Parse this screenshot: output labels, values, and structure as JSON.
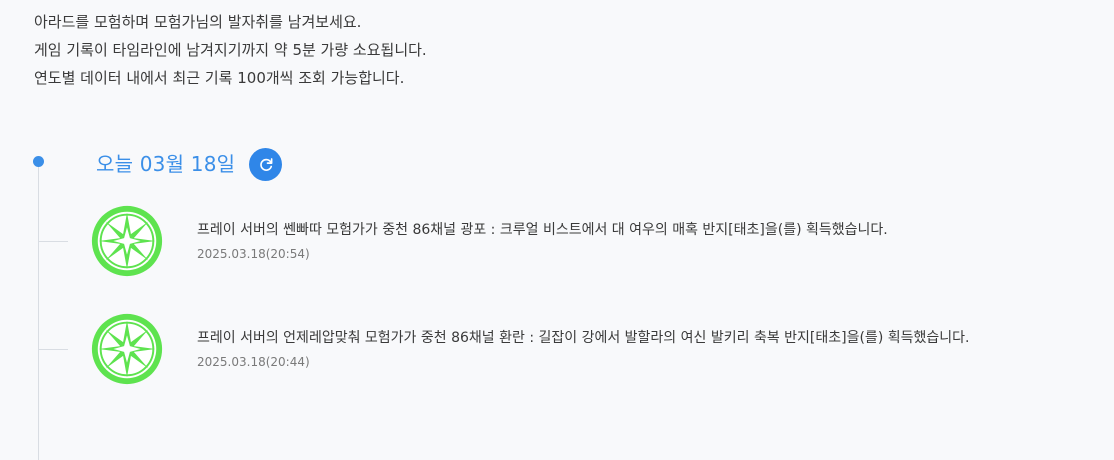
{
  "intro": {
    "line1": "아라드를 모험하며 모험가님의 발자취를 남겨보세요.",
    "line2": "게임 기록이 타임라인에 남겨지기까지 약 5분 가량 소요됩니다.",
    "line3": "연도별 데이터 내에서 최근 기록 100개씩 조회 가능합니다."
  },
  "timeline": {
    "date_label": "오늘 03월 18일",
    "entries": [
      {
        "message": "프레이 서버의 쎈빠따 모험가가 중천 86채널 광포 : 크루얼 비스트에서 대 여우의 매혹 반지[태초]을(를) 획득했습니다.",
        "time": "2025.03.18(20:54)",
        "icon": "compass-emblem-icon"
      },
      {
        "message": "프레이 서버의 언제레압맞춰 모험가가 중천 86채널 환란 : 길잡이 강에서 발할라의 여신 발키리 축복 반지[태초]을(를) 획득했습니다.",
        "time": "2025.03.18(20:44)",
        "icon": "compass-emblem-icon"
      }
    ]
  },
  "colors": {
    "accent": "#3b8fe8",
    "emblem_green": "#5ee34f",
    "background": "#f8f9fb"
  }
}
